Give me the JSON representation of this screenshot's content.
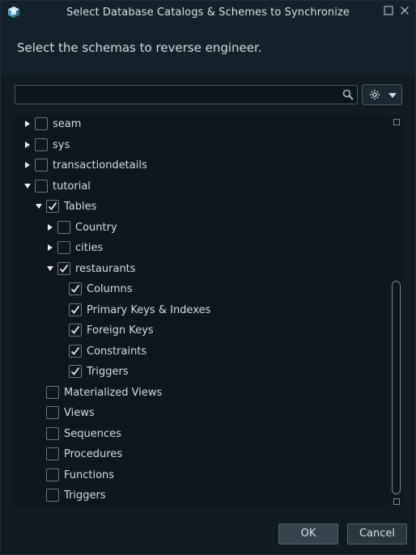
{
  "window": {
    "title": "Select Database Catalogs & Schemes to Synchronize",
    "maximize_glyph": "☐",
    "close_glyph": "✕"
  },
  "header": {
    "subtitle": "Select the schemas to reverse engineer."
  },
  "search": {
    "placeholder": "",
    "value": ""
  },
  "tree": {
    "items": [
      {
        "label": "seam",
        "level": 0,
        "expander": "collapsed",
        "checked": false
      },
      {
        "label": "sys",
        "level": 0,
        "expander": "collapsed",
        "checked": false
      },
      {
        "label": "transactiondetails",
        "level": 0,
        "expander": "collapsed",
        "checked": false
      },
      {
        "label": "tutorial",
        "level": 0,
        "expander": "expanded",
        "checked": false
      },
      {
        "label": "Tables",
        "level": 1,
        "expander": "expanded",
        "checked": true
      },
      {
        "label": "Country",
        "level": 2,
        "expander": "collapsed",
        "checked": false
      },
      {
        "label": "cities",
        "level": 2,
        "expander": "collapsed",
        "checked": false
      },
      {
        "label": "restaurants",
        "level": 2,
        "expander": "expanded",
        "checked": true
      },
      {
        "label": "Columns",
        "level": 3,
        "expander": "none",
        "checked": true
      },
      {
        "label": "Primary Keys & Indexes",
        "level": 3,
        "expander": "none",
        "checked": true
      },
      {
        "label": "Foreign Keys",
        "level": 3,
        "expander": "none",
        "checked": true
      },
      {
        "label": "Constraints",
        "level": 3,
        "expander": "none",
        "checked": true
      },
      {
        "label": "Triggers",
        "level": 3,
        "expander": "none",
        "checked": true
      },
      {
        "label": "Materialized Views",
        "level": 1,
        "expander": "none",
        "checked": false
      },
      {
        "label": "Views",
        "level": 1,
        "expander": "none",
        "checked": false
      },
      {
        "label": "Sequences",
        "level": 1,
        "expander": "none",
        "checked": false
      },
      {
        "label": "Procedures",
        "level": 1,
        "expander": "none",
        "checked": false
      },
      {
        "label": "Functions",
        "level": 1,
        "expander": "none",
        "checked": false
      },
      {
        "label": "Triggers",
        "level": 1,
        "expander": "none",
        "checked": false
      }
    ]
  },
  "footer": {
    "ok_label": "OK",
    "cancel_label": "Cancel"
  },
  "colors": {
    "background": "#101b21",
    "header": "#13222a",
    "tree_background": "#0c171c",
    "checkbox_border": "#6a7880",
    "checkmark": "#e6eef2"
  }
}
